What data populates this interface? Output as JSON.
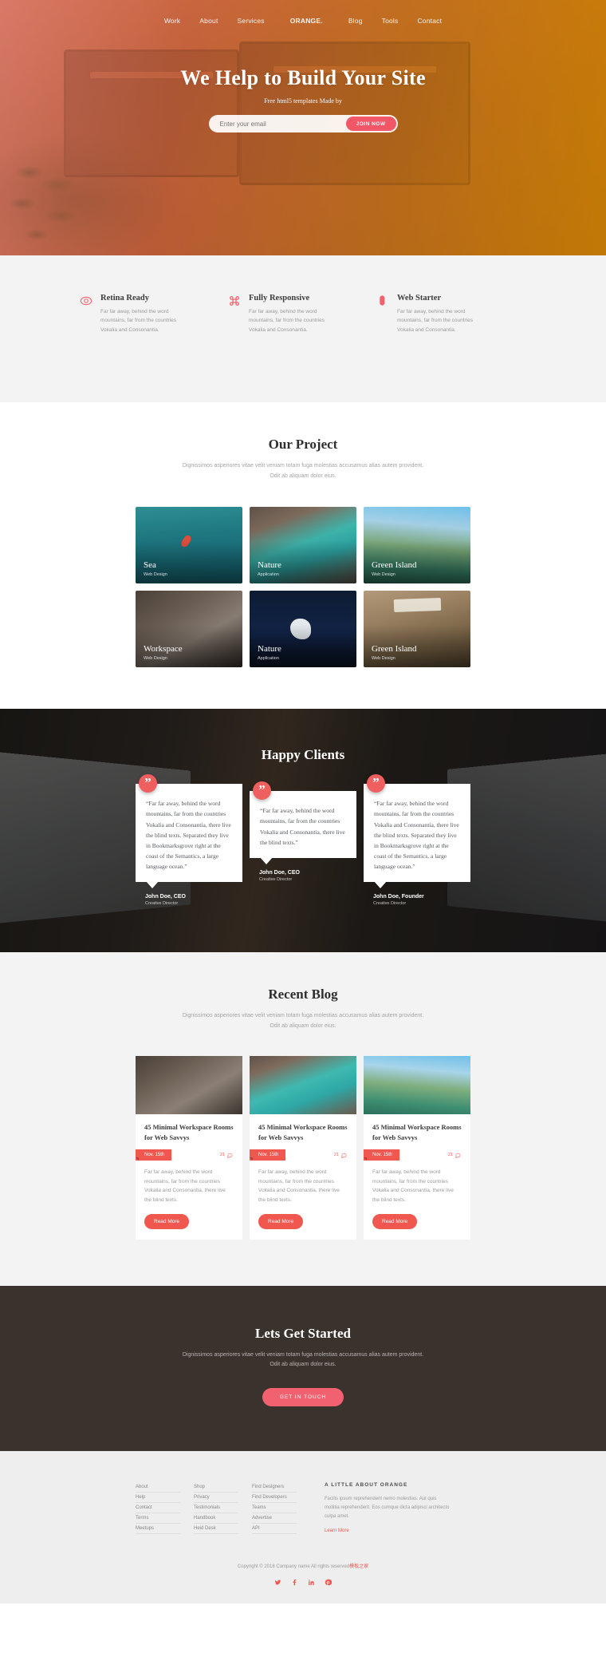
{
  "hero": {
    "nav_left": [
      {
        "label": "Work"
      },
      {
        "label": "About"
      },
      {
        "label": "Services"
      }
    ],
    "brand": "ORANGE.",
    "nav_right": [
      {
        "label": "Blog"
      },
      {
        "label": "Tools"
      },
      {
        "label": "Contact"
      }
    ],
    "title": "We Help to Build Your Site",
    "subtitle": "Free html5 templates Made by",
    "email_placeholder": "Enter your email",
    "email_value": "",
    "join_label": "JOIN NOW",
    "accent_pink": "#f25767"
  },
  "features": [
    {
      "icon": "eye-icon",
      "title": "Retina Ready",
      "text": "Far far away, behind the word mountains, far from the countries Vokalia and Consonantia."
    },
    {
      "icon": "command-icon",
      "title": "Fully Responsive",
      "text": "Far far away, behind the word mountains, far from the countries Vokalia and Consonantia."
    },
    {
      "icon": "mouse-icon",
      "title": "Web Starter",
      "text": "Far far away, behind the word mountains, far from the countries Vokalia and Consonantia."
    }
  ],
  "projects": {
    "title": "Our Project",
    "description": "Dignissimos asperiores vitae velit veniam totam fuga molestias accusamus alias autem provident. Odit ab aliquam dolor eius.",
    "items": [
      {
        "title": "Sea",
        "category": "Web Design"
      },
      {
        "title": "Nature",
        "category": "Application"
      },
      {
        "title": "Green Island",
        "category": "Web Design"
      },
      {
        "title": "Workspace",
        "category": "Web Design"
      },
      {
        "title": "Nature",
        "category": "Application"
      },
      {
        "title": "Green Island",
        "category": "Web Design"
      }
    ]
  },
  "testimonials": {
    "title": "Happy Clients",
    "quote_glyph": "”",
    "items": [
      {
        "quote": "“Far far away, behind the word mountains, far from the countries Vokalia and Consonantia, there live the blind texts. Separated they live in Bookmarksgrove right at the coast of the Semantics, a large language ocean.”",
        "name": "John Doe, CEO",
        "role": "Creative Director"
      },
      {
        "quote": "“Far far away, behind the word mountains, far from the countries Vokalia and Consonantia, there live the blind texts.”",
        "name": "John Doe, CEO",
        "role": "Creative Director"
      },
      {
        "quote": "“Far far away, behind the word mountains, far from the countries Vokalia and Consonantia, there live the blind texts. Separated they live in Bookmarksgrove right at the coast of the Semantics, a large language ocean.”",
        "name": "John Doe, Founder",
        "role": "Creative Director"
      }
    ]
  },
  "blog": {
    "title": "Recent Blog",
    "description": "Dignissimos asperiores vitae velit veniam totam fuga molestias accusamus alias autem provident. Odit ab aliquam dolor eius.",
    "posts": [
      {
        "title": "45 Minimal Workspace Rooms for Web Savvys",
        "date": "Nov. 15th",
        "comments": "21",
        "excerpt": "Far far away, behind the word mountains, far from the countries Vokalia and Consonantia, there live the blind texts.",
        "button": "Read More"
      },
      {
        "title": "45 Minimal Workspace Rooms for Web Savvys",
        "date": "Nov. 15th",
        "comments": "21",
        "excerpt": "Far far away, behind the word mountains, far from the countries Vokalia and Consonantia, there live the blind texts.",
        "button": "Read More"
      },
      {
        "title": "45 Minimal Workspace Rooms for Web Savvys",
        "date": "Nov. 15th",
        "comments": "21",
        "excerpt": "Far far away, behind the word mountains, far from the countries Vokalia and Consonantia, there live the blind texts.",
        "button": "Read More"
      }
    ]
  },
  "cta": {
    "title": "Lets Get Started",
    "description": "Dignissimos asperiores vitae velit veniam totam fuga molestias accusamus alias autem provident. Odit ab aliquam dolor eius.",
    "button": "GET IN TOUCH"
  },
  "footer": {
    "col1": [
      "About",
      "Help",
      "Contact",
      "Terms",
      "Meetups"
    ],
    "col2": [
      "Shop",
      "Privacy",
      "Testimonials",
      "Handbook",
      "Heid Desk"
    ],
    "col3": [
      "Find Designers",
      "Find Developers",
      "Teams",
      "Advertise",
      "API"
    ],
    "about_title": "A LITTLE ABOUT ORANGE",
    "about_text": "Facilis ipsum reprehenderit nemo molestias. Aut quis mollitia reprehenderit. Eos cumque dicta adipisci architecto culpa amet.",
    "about_link": "Learn More",
    "copyright_pre": "Copyright © 2018 Company name All rights reserved",
    "copyright_link": "模板之家",
    "socials": [
      "twitter-icon",
      "facebook-icon",
      "linkedin-icon",
      "pinterest-icon"
    ]
  }
}
